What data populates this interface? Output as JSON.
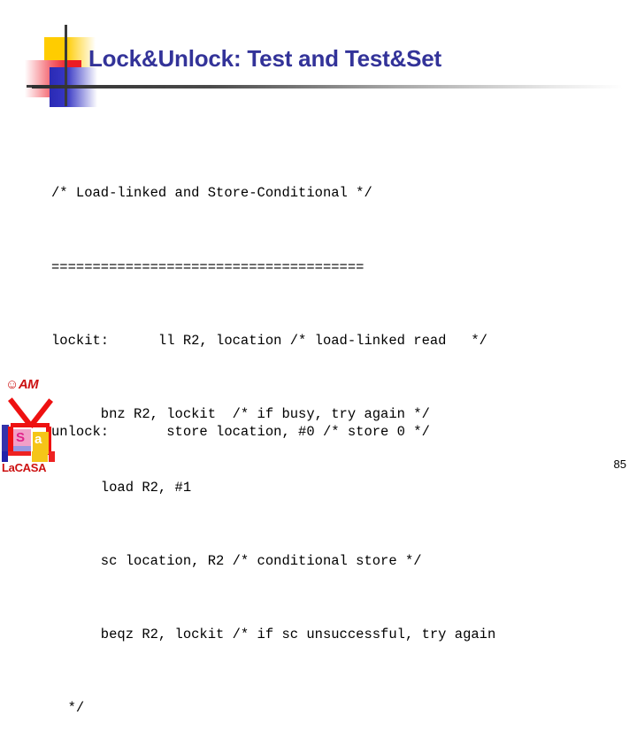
{
  "slide": {
    "title": "Lock&Unlock: Test and Test&Set",
    "page_number": "85",
    "title_color": "#333399",
    "code_color": "#000000"
  },
  "code": {
    "block_one": [
      "/* Load-linked and Store-Conditional */",
      "======================================",
      "lockit:      ll R2, location /* load-linked read   */",
      "      bnz R2, lockit  /* if busy, try again */",
      "      load R2, #1",
      "      sc location, R2 /* conditional store */",
      "      beqz R2, lockit /* if sc unsuccessful, try again",
      "  */"
    ],
    "block_two": [
      "unlock:       store location, #0 /* store 0 */"
    ]
  },
  "logo": {
    "am_text": "☺AM",
    "house_letter_s": "S",
    "house_letter_a": "a",
    "lacasa_la": "La",
    "lacasa_ca": "CA",
    "lacasa_sa": "SA"
  }
}
